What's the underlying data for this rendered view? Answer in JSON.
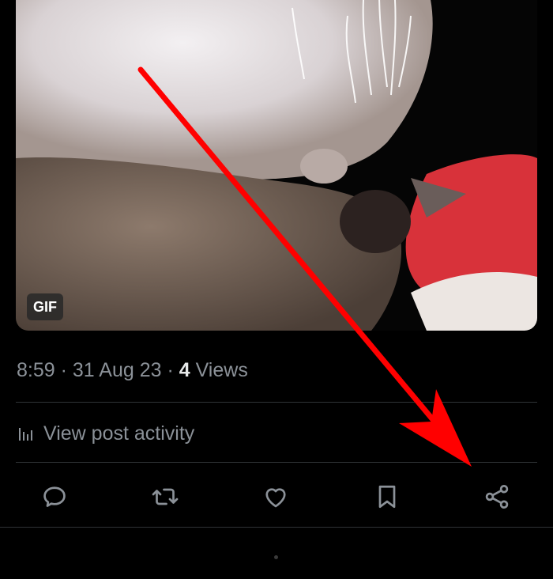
{
  "media": {
    "badge": "GIF"
  },
  "meta": {
    "time": "8:59",
    "separator": " · ",
    "date": "31 Aug 23",
    "views_count": "4",
    "views_label": " Views"
  },
  "activity": {
    "label": "View post activity",
    "icon": "bar-chart-icon"
  },
  "actions": [
    {
      "name": "reply",
      "icon": "comment-icon"
    },
    {
      "name": "repost",
      "icon": "repost-icon"
    },
    {
      "name": "like",
      "icon": "heart-icon"
    },
    {
      "name": "bookmark",
      "icon": "bookmark-icon"
    },
    {
      "name": "share",
      "icon": "share-icon"
    }
  ],
  "colors": {
    "background": "#000000",
    "text_primary": "#e7e9ea",
    "text_secondary": "#8b9198",
    "divider": "#2f3336",
    "annotation_arrow": "#ff0000"
  }
}
